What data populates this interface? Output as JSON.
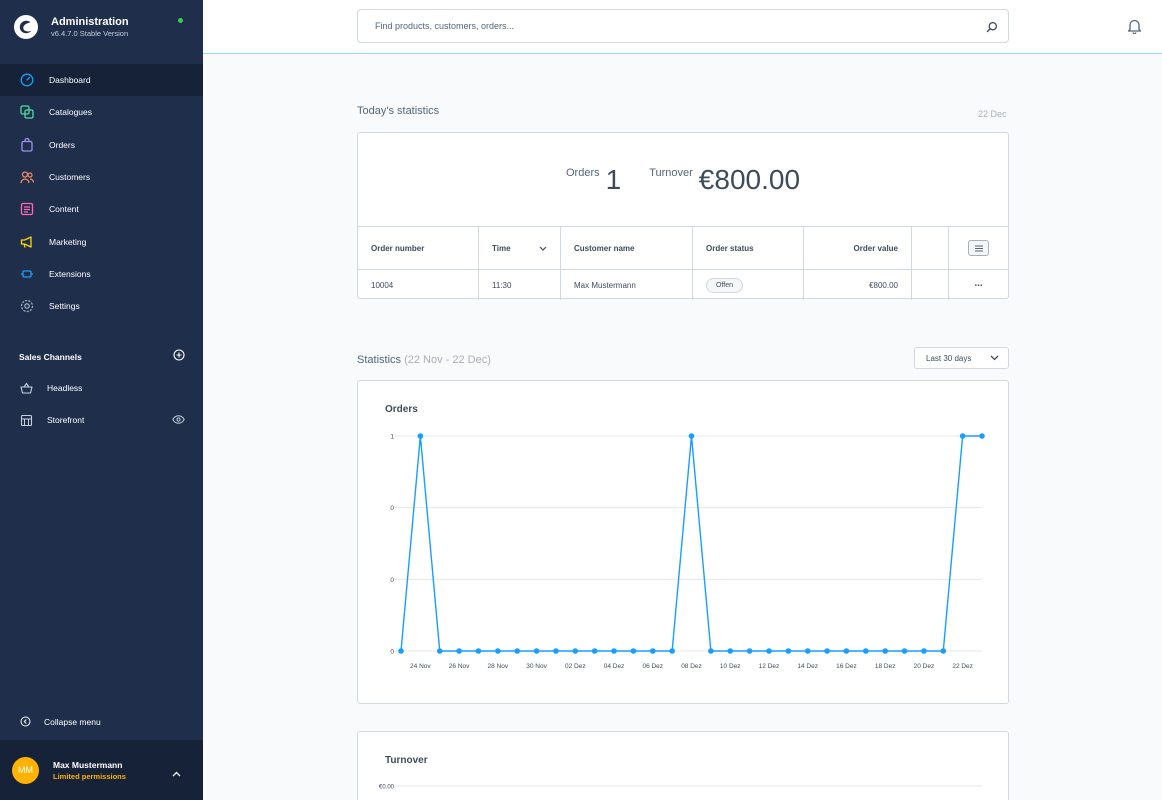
{
  "brand": {
    "title": "Administration",
    "version": "v6.4.7.0 Stable Version"
  },
  "nav": [
    {
      "label": "Dashboard",
      "icon": "dashboard-icon",
      "color": "#189eff"
    },
    {
      "label": "Catalogues",
      "icon": "catalogues-icon",
      "color": "#57d9a3"
    },
    {
      "label": "Orders",
      "icon": "orders-icon",
      "color": "#a092f0"
    },
    {
      "label": "Customers",
      "icon": "customers-icon",
      "color": "#f88962"
    },
    {
      "label": "Content",
      "icon": "content-icon",
      "color": "#ff68b4"
    },
    {
      "label": "Marketing",
      "icon": "marketing-icon",
      "color": "#ffd700"
    },
    {
      "label": "Extensions",
      "icon": "extensions-icon",
      "color": "#189eff"
    },
    {
      "label": "Settings",
      "icon": "settings-icon",
      "color": "#9aa8b5"
    }
  ],
  "sales_channels": {
    "title": "Sales Channels",
    "items": [
      {
        "label": "Headless",
        "icon": "basket-icon"
      },
      {
        "label": "Storefront",
        "icon": "storefront-icon"
      }
    ]
  },
  "collapse_label": "Collapse menu",
  "user": {
    "initials": "MM",
    "name": "Max Mustermann",
    "permissions": "Limited permissions"
  },
  "search": {
    "placeholder": "Find products, customers, orders..."
  },
  "today": {
    "title": "Today's statistics",
    "date": "22 Dec",
    "orders_label": "Orders",
    "orders_value": "1",
    "turnover_label": "Turnover",
    "turnover_value": "€800.00"
  },
  "orders_table": {
    "headers": [
      "Order number",
      "Time",
      "Customer name",
      "Order status",
      "Order value"
    ],
    "rows": [
      {
        "number": "10004",
        "time": "11:30",
        "customer": "Max Mustermann",
        "status": "Offen",
        "value": "€800.00",
        "actions": "..."
      }
    ]
  },
  "statistics": {
    "title": "Statistics",
    "range": "(22 Nov - 22 Dec)",
    "period": "Last 30 days"
  },
  "chart_data": [
    {
      "type": "line",
      "title": "Orders",
      "color": "#189eff",
      "y_ticks": [
        "1",
        "0",
        "0",
        "0"
      ],
      "x_tick_labels": [
        "24 Nov",
        "26 Nov",
        "28 Nov",
        "30 Nov",
        "02 Dez",
        "04 Dez",
        "06 Dez",
        "08 Dez",
        "10 Dez",
        "12 Dez",
        "14 Dez",
        "16 Dez",
        "18 Dez",
        "20 Dez",
        "22 Dez"
      ],
      "values": [
        0,
        1,
        0,
        0,
        0,
        0,
        0,
        0,
        0,
        0,
        0,
        0,
        0,
        0,
        0,
        1,
        0,
        0,
        0,
        0,
        0,
        0,
        0,
        0,
        0,
        0,
        0,
        0,
        0,
        1,
        1
      ],
      "ylim": [
        0,
        1
      ]
    },
    {
      "type": "line",
      "title": "Turnover",
      "y_ticks": [
        "€0.00"
      ]
    }
  ]
}
